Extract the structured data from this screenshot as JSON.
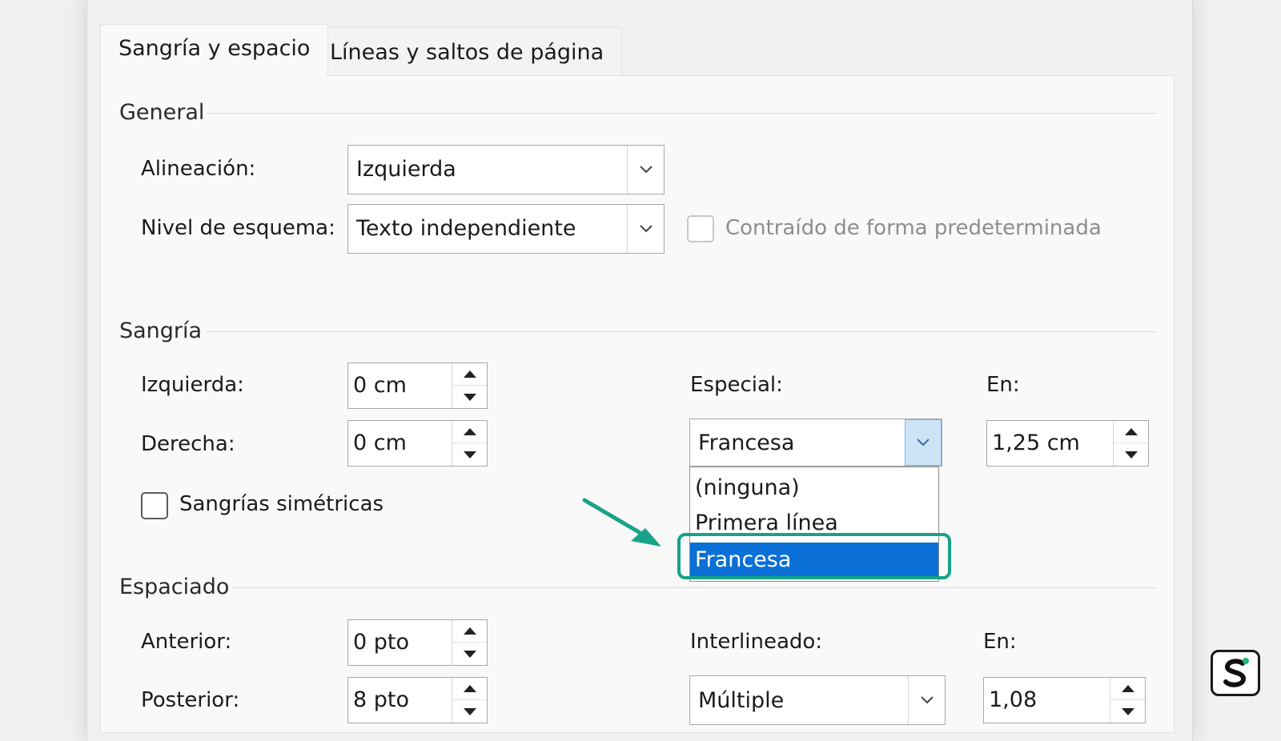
{
  "tabs": [
    {
      "label": "Sangría y espacio",
      "active": true
    },
    {
      "label": "Líneas y saltos de página",
      "active": false
    }
  ],
  "general": {
    "title": "General",
    "alignment": {
      "label": "Alineación:",
      "value": "Izquierda"
    },
    "outline_level": {
      "label": "Nivel de esquema:",
      "value": "Texto independiente"
    },
    "collapsed_default": {
      "label": "Contraído de forma predeterminada",
      "checked": false,
      "enabled": false
    }
  },
  "indent": {
    "title": "Sangría",
    "left": {
      "label": "Izquierda:",
      "value": "0 cm"
    },
    "right": {
      "label": "Derecha:",
      "value": "0 cm"
    },
    "mirror": {
      "label": "Sangrías simétricas",
      "checked": false
    },
    "special": {
      "label": "Especial:",
      "value": "Francesa",
      "options": [
        "(ninguna)",
        "Primera línea",
        "Francesa"
      ],
      "highlighted": "Francesa"
    },
    "by": {
      "label": "En:",
      "value": "1,25 cm"
    }
  },
  "spacing": {
    "title": "Espaciado",
    "before": {
      "label": "Anterior:",
      "value": "0 pto"
    },
    "after": {
      "label": "Posterior:",
      "value": "8 pto"
    },
    "line_spacing": {
      "label": "Interlineado:",
      "value": "Múltiple"
    },
    "at": {
      "label": "En:",
      "value": "1,08"
    }
  },
  "colors": {
    "accent_arrow": "#17a387",
    "selection": "#0a6fd6"
  },
  "icons": [
    "chevron-down-icon",
    "spin-up-icon",
    "spin-down-icon",
    "arrow-pointer-icon",
    "brand-logo-icon"
  ]
}
